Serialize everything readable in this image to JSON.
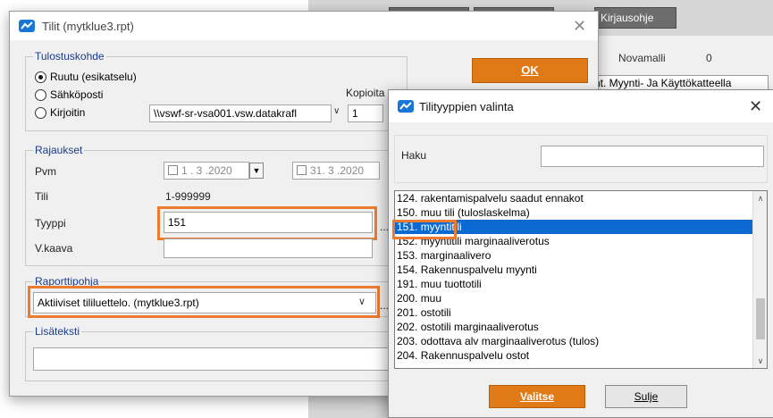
{
  "background": {
    "tab_label": "Kirjausohje",
    "novamalli_label": "Novamalli",
    "novamalli_value": "0",
    "combo_text": "nt. Myynti- Ja Käyttökatteella"
  },
  "dialog1": {
    "title": "Tilit (mytklue3.rpt)",
    "ok_label": "OK",
    "tulostuskohde": {
      "label": "Tulostuskohde",
      "options": [
        "Ruutu (esikatselu)",
        "Sähköposti",
        "Kirjoitin"
      ],
      "selected": "Ruutu (esikatselu)",
      "kopioita_label": "Kopioita",
      "printer_value": "\\\\vswf-sr-vsa001.vsw.datakrafl",
      "copies_value": "1"
    },
    "rajaukset": {
      "label": "Rajaukset",
      "pvm_label": "Pvm",
      "pvm_from": "1 . 3 .2020",
      "pvm_to": "31. 3 .2020",
      "tili_label": "Tili",
      "tili_value": "1-999999",
      "tyyppi_label": "Tyyppi",
      "tyyppi_value": "151",
      "vkaava_label": "V.kaava",
      "vkaava_value": "",
      "browse": "..."
    },
    "raporttipohja": {
      "label": "Raporttipohja",
      "value": "Aktiiviset tililuettelo. (mytklue3.rpt)"
    },
    "lisateksti": {
      "label": "Lisäteksti",
      "value": ""
    }
  },
  "dialog2": {
    "title": "Tilityyppien valinta",
    "haku_label": "Haku",
    "haku_value": "",
    "items": [
      "124. rakentamispalvelu saadut ennakot",
      "150. muu tili (tuloslaskelma)",
      "151. myyntitili",
      "152. myyntitili marginaaliverotus",
      "153. marginaalivero",
      "154. Rakennuspalvelu myynti",
      "191. muu tuottotili",
      "200. muu",
      "201. ostotili",
      "202. ostotili marginaaliverotus",
      "203. odottava alv marginaaliverotus (tulos)",
      "204. Rakennuspalvelu ostot"
    ],
    "selected_index": 2,
    "valitse_label": "Valitse",
    "sulje_label": "Sulje"
  },
  "colors": {
    "accent_orange": "#e07a16",
    "highlight_orange": "#ec7a2f",
    "selection_blue": "#0a6ad2"
  }
}
